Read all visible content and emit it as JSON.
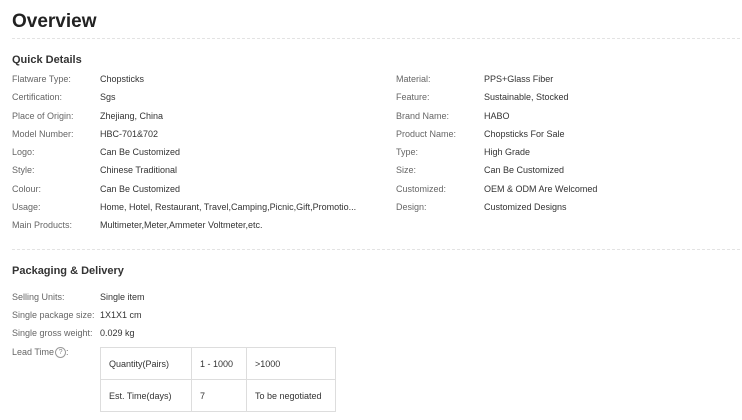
{
  "page_title": "Overview",
  "quick_details": {
    "heading": "Quick Details",
    "left": [
      {
        "label": "Flatware Type:",
        "value": "Chopsticks"
      },
      {
        "label": "Certification:",
        "value": "Sgs"
      },
      {
        "label": "Place of Origin:",
        "value": "Zhejiang, China"
      },
      {
        "label": "Model Number:",
        "value": "HBC-701&702"
      },
      {
        "label": "Logo:",
        "value": "Can Be Customized"
      },
      {
        "label": "Style:",
        "value": "Chinese Traditional"
      },
      {
        "label": "Colour:",
        "value": "Can Be Customized"
      },
      {
        "label": "Usage:",
        "value": "Home, Hotel, Restaurant, Travel,Camping,Picnic,Gift,Promotio..."
      },
      {
        "label": "Main Products:",
        "value": "Multimeter,Meter,Ammeter Voltmeter,etc."
      }
    ],
    "right": [
      {
        "label": "Material:",
        "value": "PPS+Glass Fiber"
      },
      {
        "label": "Feature:",
        "value": "Sustainable, Stocked"
      },
      {
        "label": "Brand Name:",
        "value": "HABO"
      },
      {
        "label": "Product Name:",
        "value": "Chopsticks For Sale"
      },
      {
        "label": "Type:",
        "value": "High Grade"
      },
      {
        "label": "Size:",
        "value": "Can Be Customized"
      },
      {
        "label": "Customized:",
        "value": "OEM & ODM Are Welcomed"
      },
      {
        "label": "Design:",
        "value": "Customized Designs"
      }
    ]
  },
  "packaging": {
    "heading": "Packaging & Delivery",
    "selling_units_label": "Selling Units:",
    "selling_units_value": "Single item",
    "package_size_label": "Single package size:",
    "package_size_value": "1X1X1 cm",
    "gross_weight_label": "Single gross weight:",
    "gross_weight_value": "0.029 kg",
    "lead_time_label": "Lead Time",
    "help_icon_glyph": "?",
    "lead_table": {
      "row1": [
        "Quantity(Pairs)",
        "1 - 1000",
        ">1000"
      ],
      "row2": [
        "Est. Time(days)",
        "7",
        "To be negotiated"
      ]
    }
  }
}
